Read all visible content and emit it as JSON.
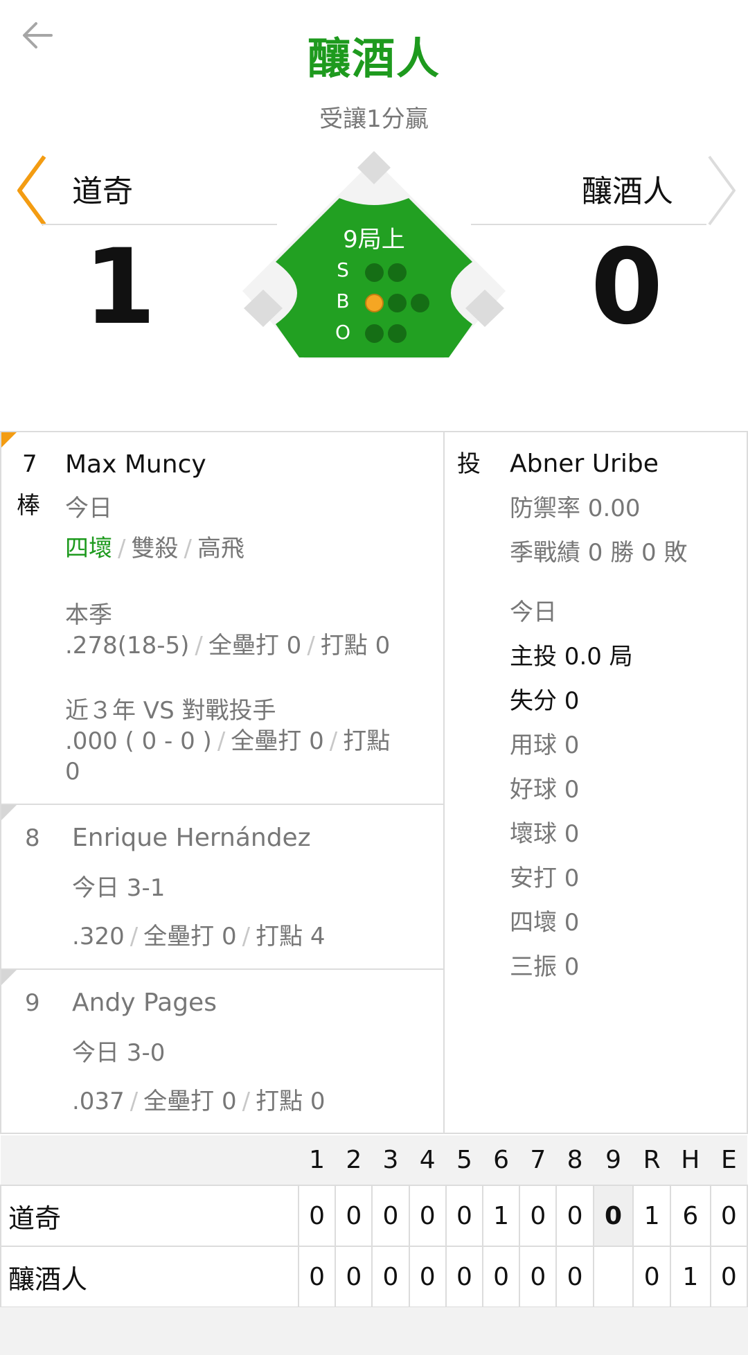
{
  "header": {
    "back_icon": "back-arrow-icon",
    "title": "釀酒人",
    "handicap": "受讓1分贏"
  },
  "game": {
    "away_team": "道奇",
    "home_team": "釀酒人",
    "away_score": "1",
    "home_score": "0",
    "inning": "9局上",
    "count": {
      "labels": [
        "S",
        "B",
        "O"
      ],
      "strikes": 0,
      "balls": 1,
      "outs": 0
    },
    "colors": {
      "accent_green": "#1e9a1e",
      "field_green": "#22a022",
      "ball_on": "#f5a623"
    }
  },
  "current_batter": {
    "order": "7",
    "order_suffix": "棒",
    "name": "Max Muncy",
    "today_label": "今日",
    "today_results": [
      "四壞",
      "雙殺",
      "高飛"
    ],
    "season_label": "本季",
    "season_avg": ".278(18-5)",
    "season_hr": "全壘打 0",
    "season_rbi": "打點 0",
    "vs_label": "近３年 VS 對戰投手",
    "vs_avg": ".000 ( 0 - 0 )",
    "vs_hr": "全壘打 0",
    "vs_rbi_line1": "打點",
    "vs_rbi_line2": "0"
  },
  "upcoming_batters": [
    {
      "order": "8",
      "name": "Enrique Hernández",
      "today": "今日 3-1",
      "avg": ".320",
      "hr": "全壘打 0",
      "rbi": "打點 4"
    },
    {
      "order": "9",
      "name": "Andy Pages",
      "today": "今日 3-0",
      "avg": ".037",
      "hr": "全壘打 0",
      "rbi": "打點 0"
    }
  ],
  "pitcher": {
    "label": "投",
    "name": "Abner Uribe",
    "era": "防禦率 0.00",
    "record": "季戰績 0 勝 0 敗",
    "today_label": "今日",
    "innings": "主投 0.0 局",
    "runs": "失分 0",
    "pitches": "用球 0",
    "strikes": "好球 0",
    "balls": "壞球 0",
    "hits": "安打 0",
    "walks": "四壞 0",
    "strikeouts": "三振 0"
  },
  "linescore": {
    "headers": [
      "1",
      "2",
      "3",
      "4",
      "5",
      "6",
      "7",
      "8",
      "9",
      "R",
      "H",
      "E"
    ],
    "rows": [
      {
        "team": "道奇",
        "cells": [
          "0",
          "0",
          "0",
          "0",
          "0",
          "1",
          "0",
          "0",
          "0",
          "1",
          "6",
          "0"
        ]
      },
      {
        "team": "釀酒人",
        "cells": [
          "0",
          "0",
          "0",
          "0",
          "0",
          "0",
          "0",
          "0",
          "",
          "0",
          "1",
          "0"
        ]
      }
    ]
  }
}
